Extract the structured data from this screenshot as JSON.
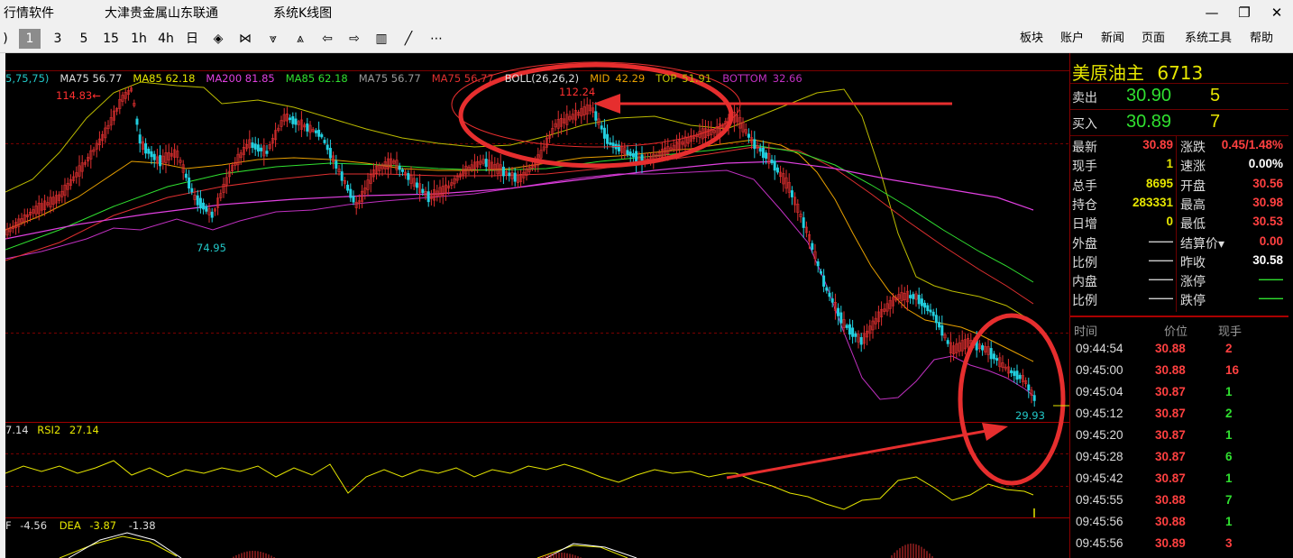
{
  "titlebar": {
    "menu": [
      "行情软件",
      "大津贵金属山东联通",
      "系统K线图"
    ],
    "controls": {
      "minimize": "—",
      "restore": "❐",
      "close": "✕"
    }
  },
  "toolbar": {
    "left_cut": ")",
    "periods": [
      "1",
      "3",
      "5",
      "15",
      "1h",
      "4h",
      "日"
    ],
    "selected_period": "1",
    "tools": [
      "◈",
      "⋈",
      "⩔",
      "⩓",
      "⇦",
      "⇨",
      "▥",
      "╱",
      "⋯"
    ],
    "right_menu": [
      "板块",
      "账户",
      "新闻",
      "页面",
      "系统工具",
      "帮助"
    ]
  },
  "chart": {
    "legend_main": [
      {
        "text": "5,75,75)",
        "color": "#22c8c8"
      },
      {
        "text": "MA75 56.77",
        "color": "#dddddd"
      },
      {
        "text": "MA85 62.18",
        "color": "#e6e600"
      },
      {
        "text": "MA200 81.85",
        "color": "#e040e0"
      },
      {
        "text": "MA85 62.18",
        "color": "#30e030"
      },
      {
        "text": "MA75 56.77",
        "color": "#9a9a9a"
      },
      {
        "text": "MA75 56.77",
        "color": "#e03030"
      },
      {
        "text": "BOLL(26,26,2)",
        "color": "#dddddd"
      },
      {
        "text": "MID",
        "color": "#e8a000"
      },
      {
        "text": "42.29",
        "color": "#e8a000"
      },
      {
        "text": "TOP",
        "color": "#bbbb00"
      },
      {
        "text": "51.91",
        "color": "#bbbb00"
      },
      {
        "text": "BOTTOM",
        "color": "#c030c0"
      },
      {
        "text": "32.66",
        "color": "#c030c0"
      }
    ],
    "annotations": {
      "high1": "114.83←",
      "high2": "112.24",
      "low1": "74.95",
      "low2": "29.93"
    },
    "rsi_legend": {
      "value_cut": "7.14",
      "name": "RSI2",
      "value": "27.14"
    },
    "macd_legend": {
      "name_cut": "F",
      "dif": "-4.56",
      "dea_name": "DEA",
      "dea": "-3.87",
      "macd": "-1.38"
    }
  },
  "quote": {
    "name": "美原油主",
    "code": "6713",
    "sell": {
      "label": "卖出",
      "price": "30.90",
      "vol": "5"
    },
    "buy": {
      "label": "买入",
      "price": "30.89",
      "vol": "7"
    },
    "fields": [
      {
        "l": "最新",
        "v": "30.89",
        "vc": "#ff4040",
        "l2": "涨跌",
        "v2": "0.45/1.48%",
        "v2c": "#ff4040"
      },
      {
        "l": "现手",
        "v": "1",
        "vc": "#e6e600",
        "l2": "速涨",
        "v2": "0.00%",
        "v2c": "#ffffff"
      },
      {
        "l": "总手",
        "v": "8695",
        "vc": "#e6e600",
        "l2": "开盘",
        "v2": "30.56",
        "v2c": "#ff4040"
      },
      {
        "l": "持仓",
        "v": "283331",
        "vc": "#e6e600",
        "l2": "最高",
        "v2": "30.98",
        "v2c": "#ff4040"
      },
      {
        "l": "日增",
        "v": "0",
        "vc": "#e6e600",
        "l2": "最低",
        "v2": "30.53",
        "v2c": "#ff4040"
      },
      {
        "l": "外盘",
        "v": "——",
        "vc": "#cccccc",
        "l2": "结算价▾",
        "v2": "0.00",
        "v2c": "#ff4040"
      },
      {
        "l": "比例",
        "v": "——",
        "vc": "#cccccc",
        "l2": "昨收",
        "v2": "30.58",
        "v2c": "#ffffff"
      },
      {
        "l": "内盘",
        "v": "——",
        "vc": "#cccccc",
        "l2": "涨停",
        "v2": "——",
        "v2c": "#30e030"
      },
      {
        "l": "比例",
        "v": "——",
        "vc": "#cccccc",
        "l2": "跌停",
        "v2": "——",
        "v2c": "#30e030"
      }
    ],
    "ticks_header": {
      "time": "时间",
      "price": "价位",
      "vol": "现手"
    },
    "ticks": [
      {
        "time": "09:44:54",
        "price": "30.88",
        "vol": "2",
        "vc": "#ff4040"
      },
      {
        "time": "09:45:00",
        "price": "30.88",
        "vol": "16",
        "vc": "#ff4040"
      },
      {
        "time": "09:45:04",
        "price": "30.87",
        "vol": "1",
        "vc": "#30e030"
      },
      {
        "time": "09:45:12",
        "price": "30.87",
        "vol": "2",
        "vc": "#30e030"
      },
      {
        "time": "09:45:20",
        "price": "30.87",
        "vol": "1",
        "vc": "#30e030"
      },
      {
        "time": "09:45:28",
        "price": "30.87",
        "vol": "6",
        "vc": "#30e030"
      },
      {
        "time": "09:45:42",
        "price": "30.87",
        "vol": "1",
        "vc": "#30e030"
      },
      {
        "time": "09:45:55",
        "price": "30.88",
        "vol": "7",
        "vc": "#30e030"
      },
      {
        "time": "09:45:56",
        "price": "30.88",
        "vol": "1",
        "vc": "#30e030"
      },
      {
        "time": "09:45:56",
        "price": "30.89",
        "vol": "3",
        "vc": "#ff4040"
      }
    ]
  }
}
